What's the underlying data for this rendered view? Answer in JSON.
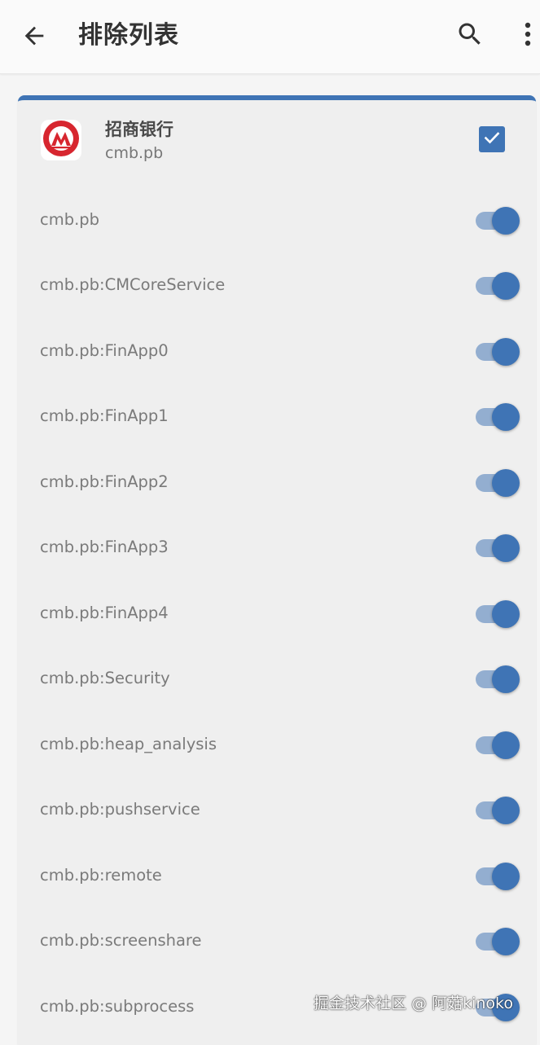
{
  "appbar": {
    "title": "排除列表",
    "back_icon": "arrow-left-icon",
    "search_icon": "search-icon",
    "more_icon": "more-vertical-icon"
  },
  "app": {
    "name": "招商银行",
    "package": "cmb.pb",
    "selected": true,
    "logo_icon": "cmb-logo-icon"
  },
  "processes": [
    {
      "label": "cmb.pb",
      "enabled": true
    },
    {
      "label": "cmb.pb:CMCoreService",
      "enabled": true
    },
    {
      "label": "cmb.pb:FinApp0",
      "enabled": true
    },
    {
      "label": "cmb.pb:FinApp1",
      "enabled": true
    },
    {
      "label": "cmb.pb:FinApp2",
      "enabled": true
    },
    {
      "label": "cmb.pb:FinApp3",
      "enabled": true
    },
    {
      "label": "cmb.pb:FinApp4",
      "enabled": true
    },
    {
      "label": "cmb.pb:Security",
      "enabled": true
    },
    {
      "label": "cmb.pb:heap_analysis",
      "enabled": true
    },
    {
      "label": "cmb.pb:pushservice",
      "enabled": true
    },
    {
      "label": "cmb.pb:remote",
      "enabled": true
    },
    {
      "label": "cmb.pb:screenshare",
      "enabled": true
    },
    {
      "label": "cmb.pb:subprocess",
      "enabled": true
    }
  ],
  "watermark": "掘金技术社区 @ 阿菇kinoko",
  "colors": {
    "accent": "#3f74b5",
    "switch_track": "#93aed0",
    "logo_red": "#d7262f"
  }
}
